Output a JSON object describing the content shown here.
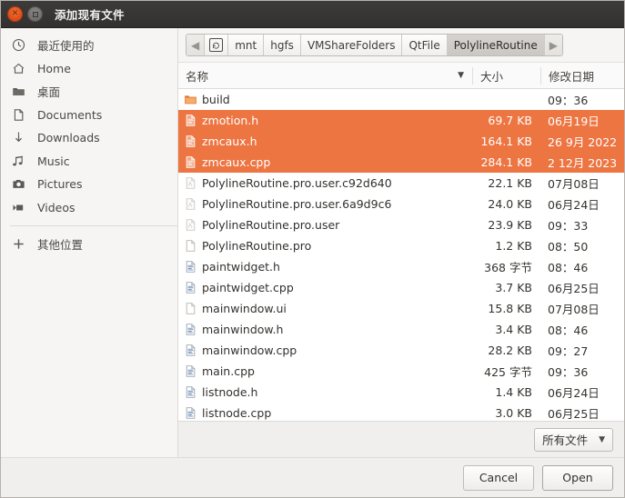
{
  "window": {
    "title": "添加现有文件",
    "close_icon": "close-icon",
    "maximize_icon": "maximize-icon"
  },
  "sidebar": {
    "items": [
      {
        "label": "最近使用的",
        "icon": "clock-icon"
      },
      {
        "label": "Home",
        "icon": "home-icon"
      },
      {
        "label": "桌面",
        "icon": "folder-icon"
      },
      {
        "label": "Documents",
        "icon": "document-icon"
      },
      {
        "label": "Downloads",
        "icon": "download-icon"
      },
      {
        "label": "Music",
        "icon": "music-note-icon"
      },
      {
        "label": "Pictures",
        "icon": "camera-icon"
      },
      {
        "label": "Videos",
        "icon": "video-icon"
      }
    ],
    "other_locations": {
      "label": "其他位置",
      "icon": "plus-icon"
    }
  },
  "pathbar": {
    "back_arrow": "◀",
    "forward_arrow": "▶",
    "device_icon": "drive-icon",
    "crumbs": [
      "mnt",
      "hgfs",
      "VMShareFolders",
      "QtFile",
      "PolylineRoutine"
    ],
    "current_index": 4
  },
  "columns": {
    "name": "名称",
    "size": "大小",
    "modified": "修改日期",
    "sort_indicator": "▼"
  },
  "files": [
    {
      "name": "build",
      "size": "",
      "date": "09：36",
      "icon": "folder-icon",
      "selected": false
    },
    {
      "name": "zmotion.h",
      "size": "69.7 KB",
      "date": "06月19日",
      "icon": "text-file-icon",
      "selected": true
    },
    {
      "name": "zmcaux.h",
      "size": "164.1 KB",
      "date": "26 9月 2022",
      "icon": "text-file-icon",
      "selected": true
    },
    {
      "name": "zmcaux.cpp",
      "size": "284.1 KB",
      "date": "2 12月 2023",
      "icon": "text-file-icon",
      "selected": true
    },
    {
      "name": "PolylineRoutine.pro.user.c92d640",
      "size": "22.1 KB",
      "date": "07月08日",
      "icon": "xml-file-icon",
      "selected": false
    },
    {
      "name": "PolylineRoutine.pro.user.6a9d9c6",
      "size": "24.0 KB",
      "date": "06月24日",
      "icon": "xml-file-icon",
      "selected": false
    },
    {
      "name": "PolylineRoutine.pro.user",
      "size": "23.9 KB",
      "date": "09：33",
      "icon": "xml-file-icon",
      "selected": false
    },
    {
      "name": "PolylineRoutine.pro",
      "size": "1.2 KB",
      "date": "08：50",
      "icon": "blank-file-icon",
      "selected": false
    },
    {
      "name": "paintwidget.h",
      "size": "368 字节",
      "date": "08：46",
      "icon": "text-file-icon",
      "selected": false
    },
    {
      "name": "paintwidget.cpp",
      "size": "3.7 KB",
      "date": "06月25日",
      "icon": "text-file-icon",
      "selected": false
    },
    {
      "name": "mainwindow.ui",
      "size": "15.8 KB",
      "date": "07月08日",
      "icon": "blank-file-icon",
      "selected": false
    },
    {
      "name": "mainwindow.h",
      "size": "3.4 KB",
      "date": "08：46",
      "icon": "text-file-icon",
      "selected": false
    },
    {
      "name": "mainwindow.cpp",
      "size": "28.2 KB",
      "date": "09：27",
      "icon": "text-file-icon",
      "selected": false
    },
    {
      "name": "main.cpp",
      "size": "425 字节",
      "date": "09：36",
      "icon": "text-file-icon",
      "selected": false
    },
    {
      "name": "listnode.h",
      "size": "1.4 KB",
      "date": "06月24日",
      "icon": "text-file-icon",
      "selected": false
    },
    {
      "name": "listnode.cpp",
      "size": "3.0 KB",
      "date": "06月25日",
      "icon": "text-file-icon",
      "selected": false
    }
  ],
  "footer": {
    "filter_label": "所有文件",
    "filter_caret": "▼",
    "cancel_label": "Cancel",
    "open_label": "Open"
  },
  "colors": {
    "selection": "#ed7542",
    "titlebar": "#3d3b39",
    "close_button": "#dd4814",
    "sidebar_bg": "#f6f5f4"
  }
}
